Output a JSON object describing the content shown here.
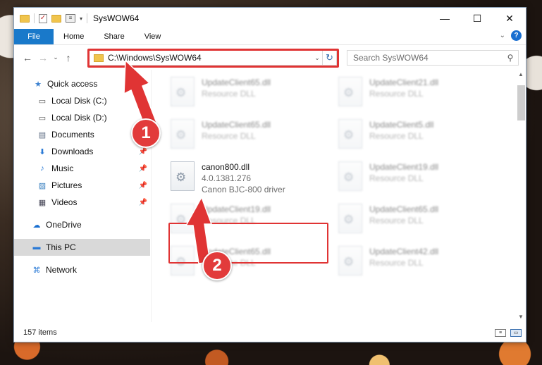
{
  "window": {
    "title": "SysWOW64",
    "minimize": "—",
    "maximize": "☐",
    "close": "✕"
  },
  "ribbon": {
    "tabs": [
      "File",
      "Home",
      "Share",
      "View"
    ],
    "help": "?",
    "collapse": "⌄"
  },
  "address": {
    "path": "C:\\Windows\\SysWOW64",
    "refresh": "↻",
    "dropdown": "⌄"
  },
  "nav_buttons": {
    "back": "←",
    "forward": "→",
    "recent": "⌄",
    "up": "↑"
  },
  "search": {
    "placeholder": "Search SysWOW64",
    "icon": "⚲"
  },
  "sidebar": {
    "items": [
      {
        "label": "Quick access",
        "icon": "★",
        "pinned": false
      },
      {
        "label": "Local Disk (C:)",
        "icon": "▭",
        "pinned": true
      },
      {
        "label": "Local Disk (D:)",
        "icon": "▭",
        "pinned": false
      },
      {
        "label": "Documents",
        "icon": "▤",
        "pinned": true
      },
      {
        "label": "Downloads",
        "icon": "⬇",
        "pinned": true
      },
      {
        "label": "Music",
        "icon": "♪",
        "pinned": true
      },
      {
        "label": "Pictures",
        "icon": "▨",
        "pinned": true
      },
      {
        "label": "Videos",
        "icon": "▦",
        "pinned": true
      },
      {
        "label": "OneDrive",
        "icon": "☁",
        "pinned": false
      },
      {
        "label": "This PC",
        "icon": "▬",
        "pinned": false
      },
      {
        "label": "Network",
        "icon": "⌘",
        "pinned": false
      }
    ],
    "pin_glyph": "📌"
  },
  "files": [
    {
      "name": "UpdateClient65.dll",
      "line2": "Resource DLL",
      "line3": ""
    },
    {
      "name": "UpdateClient21.dll",
      "line2": "Resource DLL",
      "line3": ""
    },
    {
      "name": "UpdateClient65.dll",
      "line2": "Resource DLL",
      "line3": ""
    },
    {
      "name": "UpdateClient5.dll",
      "line2": "Resource DLL",
      "line3": ""
    },
    {
      "name": "canon800.dll",
      "line2": "4.0.1381.276",
      "line3": "Canon BJC-800 driver"
    },
    {
      "name": "UpdateClient19.dll",
      "line2": "Resource DLL",
      "line3": ""
    },
    {
      "name": "UpdateClient19.dll",
      "line2": "Resource DLL",
      "line3": ""
    },
    {
      "name": "UpdateClient65.dll",
      "line2": "Resource DLL",
      "line3": ""
    },
    {
      "name": "UpdateClient65.dll",
      "line2": "Resource DLL",
      "line3": ""
    },
    {
      "name": "UpdateClient42.dll",
      "line2": "Resource DLL",
      "line3": ""
    }
  ],
  "status": {
    "count": "157 items"
  },
  "annotations": {
    "step1": "1",
    "step2": "2",
    "accent": "#e03434"
  }
}
